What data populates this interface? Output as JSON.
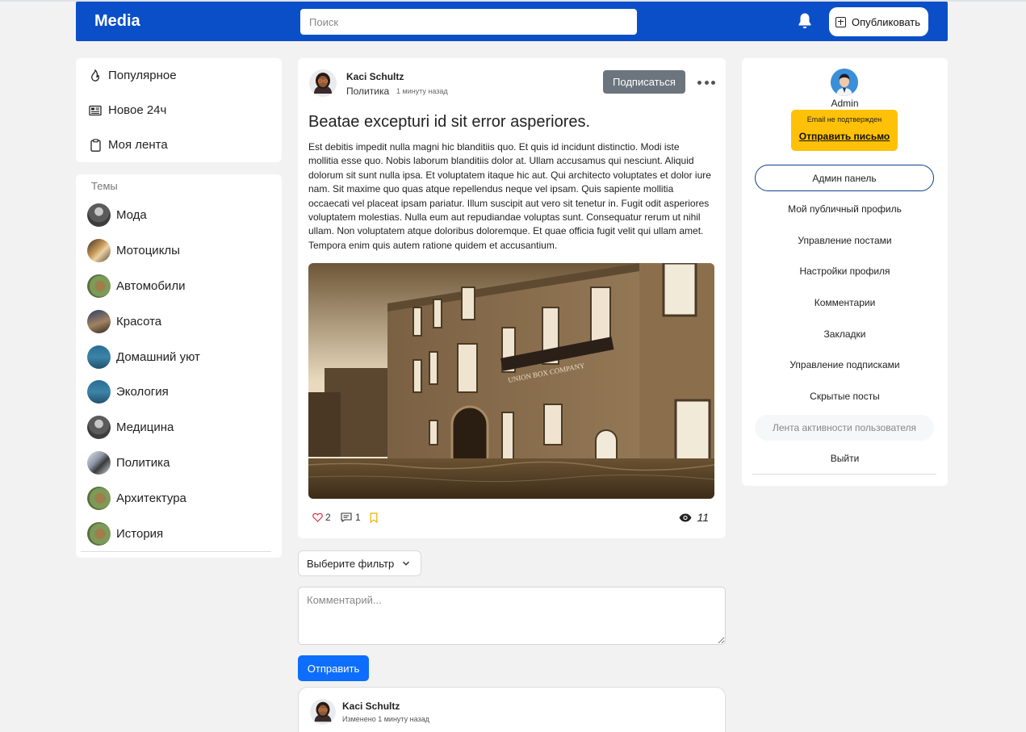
{
  "header": {
    "brand": "Media",
    "search_placeholder": "Поиск",
    "publish_label": "Опубликовать"
  },
  "nav": {
    "items": [
      {
        "label": "Популярное",
        "icon": "fire-icon"
      },
      {
        "label": "Новое 24ч",
        "icon": "newspaper-icon"
      },
      {
        "label": "Моя лента",
        "icon": "clipboard-icon"
      }
    ]
  },
  "topics": {
    "title": "Темы",
    "items": [
      {
        "label": "Мода"
      },
      {
        "label": "Мотоциклы"
      },
      {
        "label": "Автомобили"
      },
      {
        "label": "Красота"
      },
      {
        "label": "Домашний уют"
      },
      {
        "label": "Экология"
      },
      {
        "label": "Медицина"
      },
      {
        "label": "Политика"
      },
      {
        "label": "Архитектура"
      },
      {
        "label": "История"
      }
    ]
  },
  "post": {
    "author": "Kaci Schultz",
    "category": "Политика",
    "time": "1 минуту назад",
    "subscribe_label": "Подписаться",
    "title": "Beatae excepturi id sit error asperiores.",
    "body": "Est debitis impedit nulla magni hic blanditiis quo. Et quis id incidunt distinctio. Modi iste mollitia esse quo. Nobis laborum blanditiis dolor at. Ullam accusamus qui nesciunt. Aliquid dolorum sit sunt nulla ipsa. Et voluptatem itaque hic aut. Qui architecto voluptates et dolor iure nam. Sit maxime quo quas atque repellendus neque vel ipsam. Quis sapiente mollitia occaecati vel placeat ipsam pariatur. Illum suscipit aut vero sit tenetur in. Fugit odit asperiores voluptatem molestias. Nulla eum aut repudiandae voluptas sunt. Consequatur rerum ut nihil ullam. Non voluptatem atque doloribus doloremque. Et quae officia fugit velit qui ullam amet. Tempora enim quis autem ratione quidem et accusantium.",
    "image_sign_text": "UNION BOX COMPANY",
    "likes": "2",
    "comments": "1",
    "views": "11"
  },
  "filter": {
    "label": "Выберите фильтр"
  },
  "comment_form": {
    "placeholder": "Комментарий...",
    "submit_label": "Отправить"
  },
  "comment": {
    "author": "Kaci Schultz",
    "meta": "Изменено 1 минуту назад"
  },
  "sidebar_right": {
    "user_name": "Admin",
    "email_warning": "Email не подтвержден",
    "send_email_label": "Отправить письмо",
    "admin_panel_label": "Админ панель",
    "menu": [
      "Мой публичный профиль",
      "Управление постами",
      "Настройки профиля",
      "Комментарии",
      "Закладки",
      "Управление подписками",
      "Скрытые посты",
      "Лента активности пользователя",
      "Выйти"
    ]
  },
  "colors": {
    "header_bg": "#0b4fc8",
    "primary": "#0d6efd",
    "secondary": "#6c757d",
    "warning": "#ffc107"
  }
}
